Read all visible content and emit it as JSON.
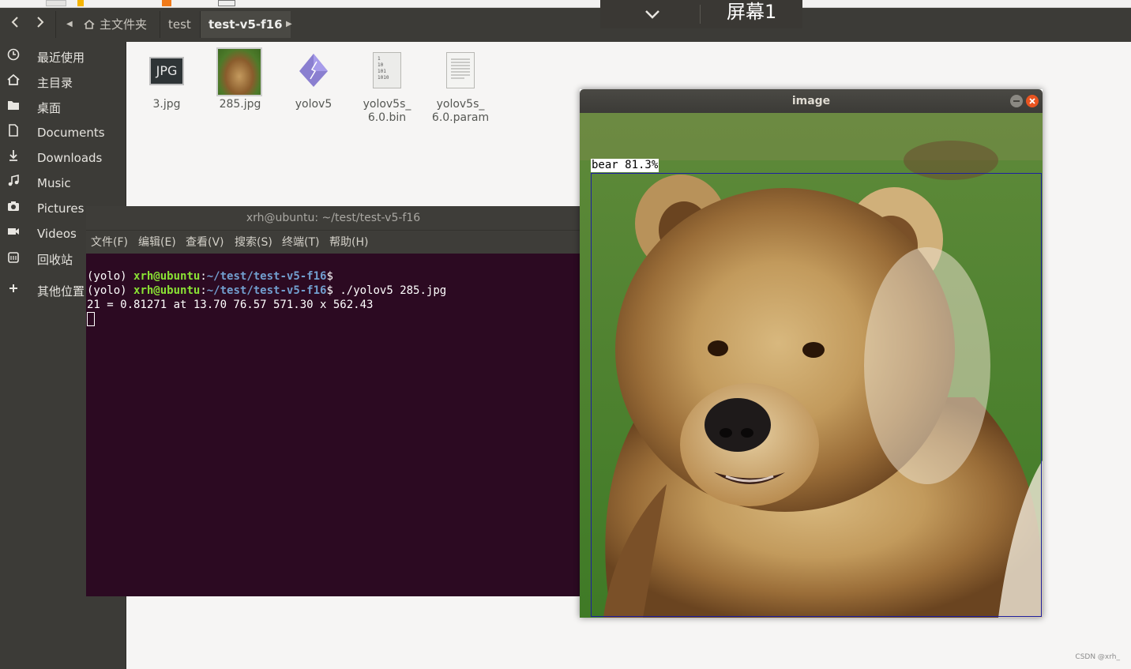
{
  "pathbar": {
    "back_icon": "chevron-left-icon",
    "forward_icon": "chevron-right-icon",
    "crumbs": [
      "主文件夹",
      "test",
      "test-v5-f16"
    ],
    "active_crumb": "test-v5-f16"
  },
  "screen_pill": {
    "label": "屏幕1",
    "icon": "chevron-down-icon"
  },
  "sidebar": {
    "items": [
      {
        "label": "最近使用",
        "icon": "clock-icon"
      },
      {
        "label": "主目录",
        "icon": "home-icon"
      },
      {
        "label": "桌面",
        "icon": "folder-icon"
      },
      {
        "label": "Documents",
        "icon": "document-icon"
      },
      {
        "label": "Downloads",
        "icon": "download-icon"
      },
      {
        "label": "Music",
        "icon": "music-icon"
      },
      {
        "label": "Pictures",
        "icon": "camera-icon"
      },
      {
        "label": "Videos",
        "icon": "video-icon"
      },
      {
        "label": "回收站",
        "icon": "trash-icon"
      },
      {
        "label": "其他位置",
        "icon": "plus-icon"
      }
    ]
  },
  "files": [
    {
      "name": "3.jpg",
      "icon_text": "JPG",
      "icon": "jpg-file-icon"
    },
    {
      "name": "285.jpg",
      "icon": "image-thumbnail"
    },
    {
      "name": "yolov5",
      "icon": "executable-icon"
    },
    {
      "name_line1": "yolov5s_",
      "name_line2": "6.0.bin",
      "icon": "binary-file-icon",
      "icon_text_lines": [
        "1",
        "10",
        "101",
        "1010"
      ]
    },
    {
      "name_line1": "yolov5s_",
      "name_line2": "6.0.param",
      "icon": "text-file-icon"
    }
  ],
  "terminal": {
    "title": "xrh@ubuntu: ~/test/test-v5-f16",
    "menu": [
      "文件(F)",
      "编辑(E)",
      "查看(V)",
      "搜索(S)",
      "终端(T)",
      "帮助(H)"
    ],
    "lines": [
      {
        "env": "(yolo) ",
        "user": "xrh@ubuntu",
        "path": "~/test/test-v5-f16",
        "cmd": ""
      },
      {
        "env": "(yolo) ",
        "user": "xrh@ubuntu",
        "path": "~/test/test-v5-f16",
        "cmd": " ./yolov5 285.jpg"
      }
    ],
    "output": "21 = 0.81271 at 13.70 76.57 571.30 x 562.43"
  },
  "image_window": {
    "title": "image",
    "detection_label": "bear 81.3%",
    "minimize_icon": "minimize-icon",
    "close_icon": "close-icon"
  },
  "watermark": "CSDN @xrh_"
}
